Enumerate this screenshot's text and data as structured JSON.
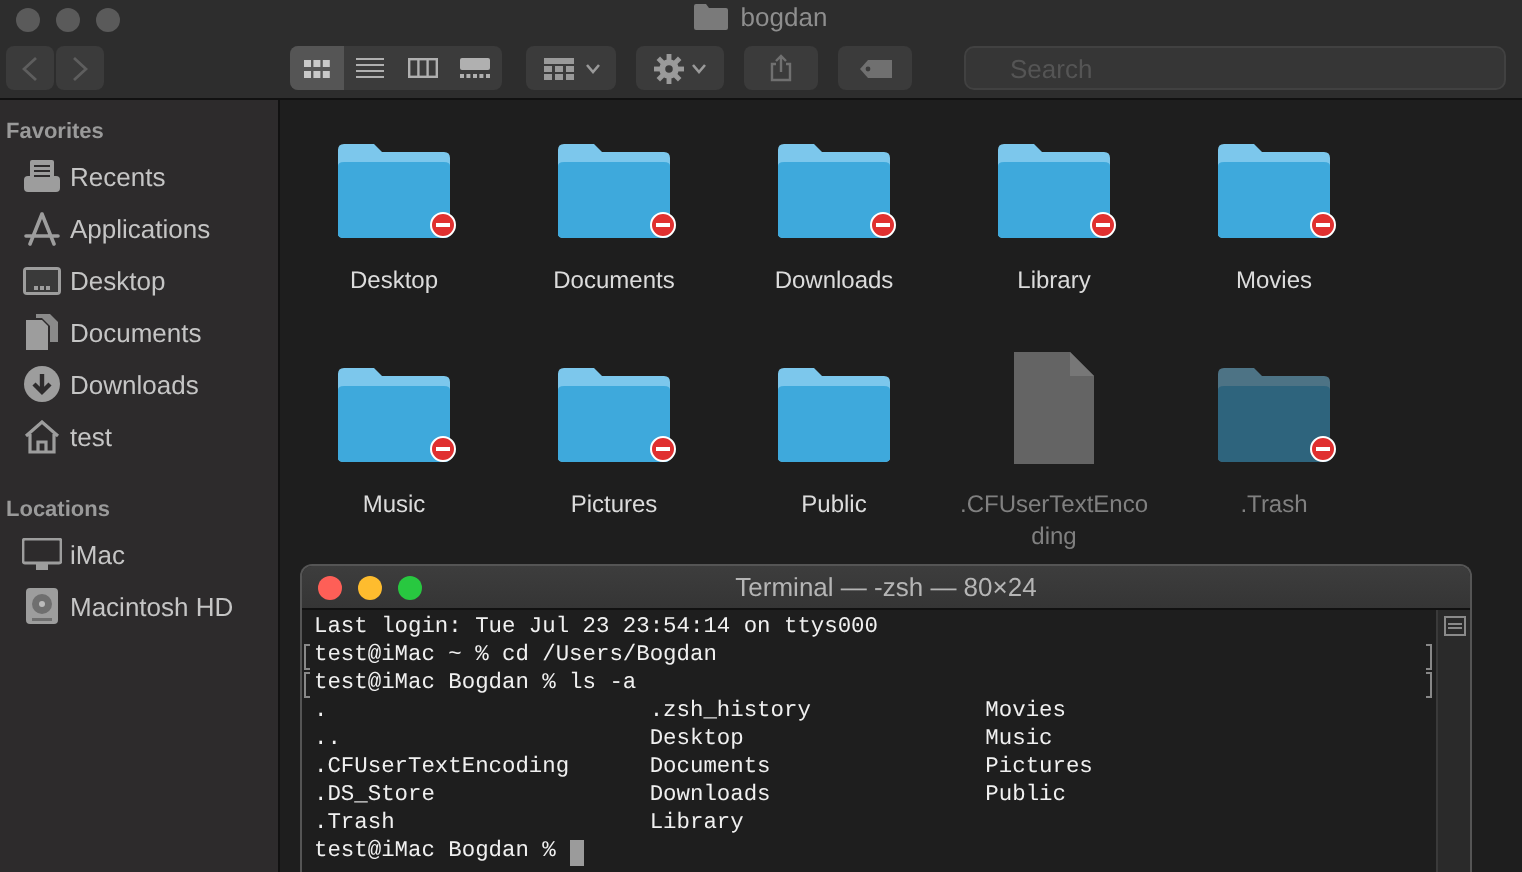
{
  "finder": {
    "title": "bogdan",
    "toolbar": {
      "back": {
        "disabled": true
      },
      "forward": {
        "disabled": true
      },
      "view_modes": [
        {
          "kind": "icons",
          "selected": true
        },
        {
          "kind": "list",
          "selected": false
        },
        {
          "kind": "columns",
          "selected": false
        },
        {
          "kind": "gallery",
          "selected": false
        }
      ],
      "search": {
        "placeholder": "Search"
      }
    },
    "sidebar": [
      {
        "header": "Favorites",
        "items": [
          {
            "label": "Recents",
            "kind": "recents"
          },
          {
            "label": "Applications",
            "kind": "applications"
          },
          {
            "label": "Desktop",
            "kind": "desktop"
          },
          {
            "label": "Documents",
            "kind": "documents"
          },
          {
            "label": "Downloads",
            "kind": "downloads"
          },
          {
            "label": "test",
            "kind": "home"
          }
        ]
      },
      {
        "header": "Locations",
        "items": [
          {
            "label": "iMac",
            "kind": "computer"
          },
          {
            "label": "Macintosh HD",
            "kind": "disk"
          }
        ]
      }
    ],
    "items": [
      {
        "name": "Desktop",
        "kind": "folder",
        "locked": true,
        "hidden": false
      },
      {
        "name": "Documents",
        "kind": "folder",
        "locked": true,
        "hidden": false
      },
      {
        "name": "Downloads",
        "kind": "folder",
        "locked": true,
        "hidden": false
      },
      {
        "name": "Library",
        "kind": "folder",
        "locked": true,
        "hidden": false
      },
      {
        "name": "Movies",
        "kind": "folder",
        "locked": true,
        "hidden": false
      },
      {
        "name": "Music",
        "kind": "folder",
        "locked": true,
        "hidden": false
      },
      {
        "name": "Pictures",
        "kind": "folder",
        "locked": true,
        "hidden": false
      },
      {
        "name": "Public",
        "kind": "folder",
        "locked": false,
        "hidden": false
      },
      {
        "name": ".CFUserTextEncoding",
        "kind": "file",
        "locked": false,
        "hidden": true
      },
      {
        "name": ".Trash",
        "kind": "folder",
        "locked": true,
        "hidden": true
      }
    ]
  },
  "terminal": {
    "title": "Terminal — -zsh — 80×24",
    "cursor": true,
    "lines": [
      {
        "text": "Last login: Tue Jul 23 23:54:14 on ttys000",
        "marked": false
      },
      {
        "text": "test@iMac ~ % cd /Users/Bogdan",
        "marked": true
      },
      {
        "text": "test@iMac Bogdan % ls -a",
        "marked": true
      },
      {
        "text": ".                        .zsh_history             Movies",
        "marked": false
      },
      {
        "text": "..                       Desktop                  Music",
        "marked": false
      },
      {
        "text": ".CFUserTextEncoding      Documents                Pictures",
        "marked": false
      },
      {
        "text": ".DS_Store                Downloads                Public",
        "marked": false
      },
      {
        "text": ".Trash                   Library",
        "marked": false
      },
      {
        "text": "test@iMac Bogdan %",
        "marked": false
      }
    ]
  }
}
